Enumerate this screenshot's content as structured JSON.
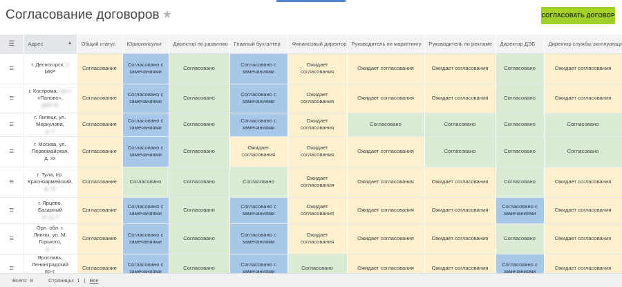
{
  "header": {
    "title": "Согласование договоров",
    "star": "★",
    "approve_button": "СОГЛАСОВАТЬ ДОГОВОР"
  },
  "table": {
    "menu_glyph": "≡",
    "columns": [
      "Адрес",
      "Общий статус",
      "Юрисконсульт",
      "Директор по развитию",
      "Главный бухгалтер",
      "Финансовый директор",
      "Руководитель по маркетингу",
      "Руководитель по рекламе",
      "Директор ДЭБ",
      "Директор службы эксплуатации"
    ],
    "rows": [
      {
        "addr": "г. Десногорск,",
        "addr_blur": "3",
        "addr2": "МКР",
        "addr3": "",
        "cells": [
          "Согласование",
          "Согласовано с замечаниями",
          "Согласовано",
          "Согласовано с замечаниями",
          "Ожидает согласования",
          "Ожидает согласования",
          "Ожидает согласования",
          "Согласовано",
          "Ожидает согласования"
        ]
      },
      {
        "addr": "г. Кострома,",
        "addr_blur": "ххх х",
        "addr2": "«Паново»,",
        "addr3": "дом 15",
        "cells": [
          "Согласование",
          "Согласовано с замечаниями",
          "Согласовано",
          "Согласовано с замечаниями",
          "Ожидает согласования",
          "Ожидает согласования",
          "Ожидает согласования",
          "Согласовано",
          "Ожидает согласования"
        ]
      },
      {
        "addr": "г. Липецк, ул.",
        "addr_blur": "",
        "addr2": "Меркулова,",
        "addr3": "д. 2",
        "cells": [
          "Согласование",
          "Согласовано с замечаниями",
          "Согласовано",
          "Согласовано с замечаниями",
          "Ожидает согласования",
          "Согласовано",
          "Согласовано",
          "Согласовано",
          "Согласовано"
        ]
      },
      {
        "addr": "г. Москва, ул.",
        "addr_blur": "",
        "addr2": "Первомайская,",
        "addr3": "д. хх",
        "cells": [
          "Согласование",
          "Согласовано с замечаниями",
          "Согласовано",
          "Ожидает согласования",
          "Ожидает согласования",
          "Ожидает согласования",
          "Согласовано",
          "Согласовано",
          "Согласовано"
        ]
      },
      {
        "addr": "г. Тула, пр.",
        "addr_blur": "",
        "addr2": "Красноармейский,",
        "addr3": "д. 11",
        "cells": [
          "Согласование",
          "Согласовано",
          "Согласовано",
          "Согласовано",
          "Ожидает согласования",
          "Ожидает согласования",
          "Ожидает согласования",
          "Согласовано",
          "Ожидает согласования"
        ]
      },
      {
        "addr": "г. Ярцево,",
        "addr_blur": "",
        "addr2": "Базарный",
        "addr3": "хх, д. 2",
        "cells": [
          "Согласование",
          "Согласовано с замечаниями",
          "Согласовано",
          "Согласовано с замечаниями",
          "Ожидает согласования",
          "Ожидает согласования",
          "Ожидает согласования",
          "Согласовано с замечаниями",
          "Ожидает согласования"
        ]
      },
      {
        "addr": "Орл. обл. г.",
        "addr_blur": "",
        "addr2": "Ливны, ул. М.",
        "addr3": "Горького,",
        "addr4": "д. 7",
        "cells": [
          "Согласование",
          "Согласовано с замечаниями",
          "Согласовано",
          "Согласовано с замечаниями",
          "Ожидает согласования",
          "Ожидает согласования",
          "Ожидает согласования",
          "Согласовано",
          "Ожидает согласования"
        ]
      },
      {
        "addr": "Ярославь,",
        "addr_blur": "",
        "addr2": "Ленинградский",
        "addr3": "пр-т,",
        "addr4": "д. 45",
        "cells": [
          "Согласование",
          "Согласовано с замечаниями",
          "Согласовано",
          "Согласовано с замечаниями",
          "Согласовано",
          "Ожидает согласования",
          "Ожидает согласования",
          "Согласовано с замечаниями",
          "Ожидает согласования"
        ]
      }
    ]
  },
  "footer": {
    "total_label": "Всего:",
    "total_value": "8",
    "pages_label": "Страницы:",
    "pages_value": "1",
    "sep": "|",
    "all_link": "Все"
  }
}
